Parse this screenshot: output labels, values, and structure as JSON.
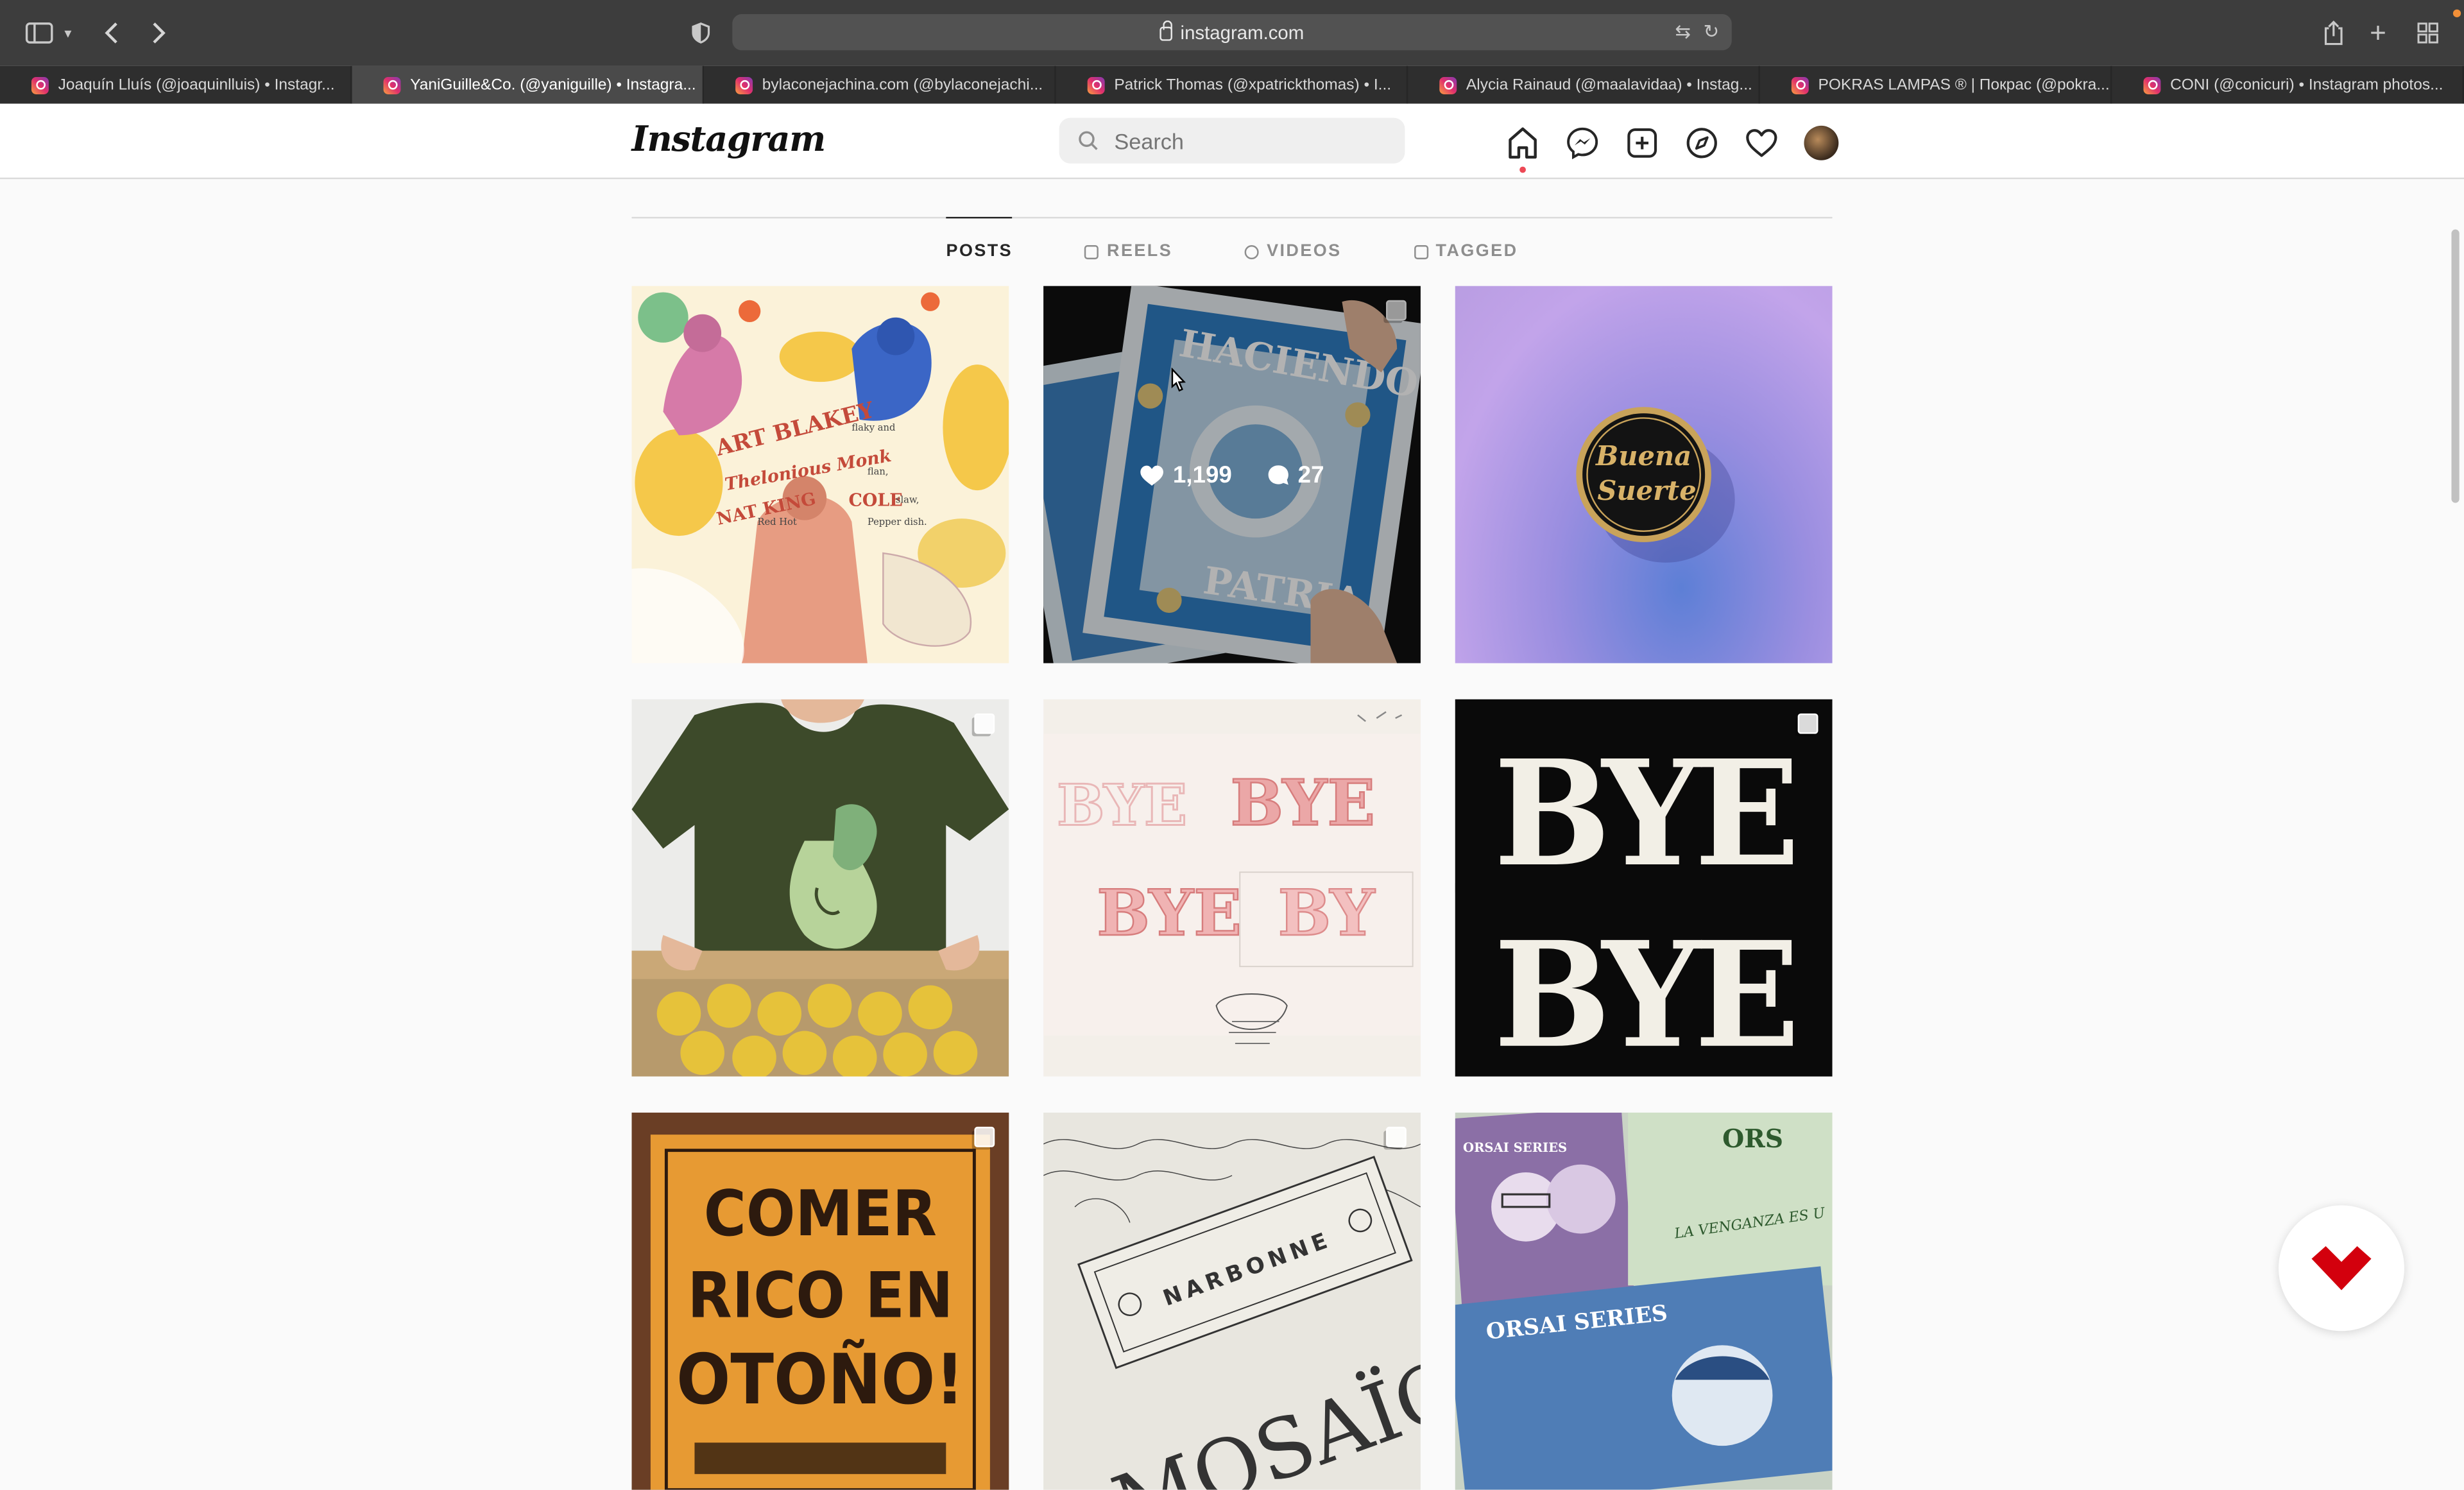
{
  "browser": {
    "url": "instagram.com",
    "tabs": [
      {
        "label": "Joaquín Lluís (@joaquinlluis) • Instagr...",
        "active": false
      },
      {
        "label": "YaniGuille&Co. (@yaniguille) • Instagra...",
        "active": true
      },
      {
        "label": "bylaconejachina.com (@bylaconejachi...",
        "active": false
      },
      {
        "label": "Patrick Thomas (@xpatrickthomas) • I...",
        "active": false
      },
      {
        "label": "Alycia Rainaud (@maalavidaa) • Instag...",
        "active": false
      },
      {
        "label": "POKRAS LAMPAS ® | Покрас (@pokra...",
        "active": false
      },
      {
        "label": "CONI (@conicuri) • Instagram photos...",
        "active": false
      }
    ]
  },
  "nav": {
    "logo": "Instagram",
    "search_placeholder": "Search"
  },
  "profile_tabs": [
    {
      "label": "POSTS",
      "icon": "grid-icon",
      "active": true
    },
    {
      "label": "REELS",
      "icon": "reels-icon",
      "active": false
    },
    {
      "label": "VIDEOS",
      "icon": "video-icon",
      "active": false
    },
    {
      "label": "TAGGED",
      "icon": "tagged-icon",
      "active": false
    }
  ],
  "posts": [
    {
      "id": "art-blakey",
      "multi": false,
      "art_text": [
        "ART BLAKEY",
        "flaky and",
        "Thelonious Monk",
        "flan,",
        "NAT KING",
        "COLE",
        "slaw,",
        "Red Hot",
        "Pepper dish."
      ]
    },
    {
      "id": "poster-patria",
      "multi": true,
      "likes": "1,199",
      "comments": "27",
      "hovered": true,
      "art_text": [
        "HACIENDO",
        "PATRIA"
      ]
    },
    {
      "id": "buena-suerte-pin",
      "multi": false,
      "art_text": [
        "Buena",
        "Suerte"
      ]
    },
    {
      "id": "pear-tshirt",
      "multi": true
    },
    {
      "id": "bye-bye-sketch",
      "multi": false,
      "art_text": [
        "BYE",
        "BYE",
        "BYE",
        "BY"
      ]
    },
    {
      "id": "bye-bye-black",
      "multi": true,
      "art_text": [
        "BYE",
        "BYE"
      ]
    },
    {
      "id": "comer-rico",
      "multi": true,
      "art_text": [
        "COMER",
        "RICO EN",
        "OTOÑO!"
      ]
    },
    {
      "id": "narbonne-mosaic",
      "multi": true,
      "art_text": [
        "NARBONNE",
        "MOSAÏC"
      ]
    },
    {
      "id": "orsai-series",
      "multi": false,
      "art_text": [
        "ORSAI SERIES",
        "LA VENGANZA ES U",
        "ORS"
      ]
    }
  ],
  "colors": {
    "ig_red_dot": "#ed4956",
    "fab_logo": "#d3000d"
  }
}
